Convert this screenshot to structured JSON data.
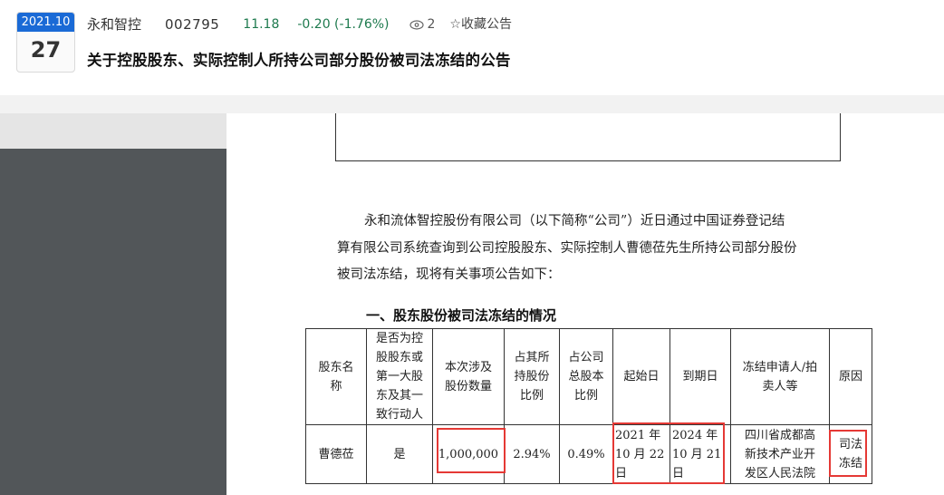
{
  "header": {
    "date_year_month": "2021.10",
    "date_day": "27",
    "company_name": "永和智控",
    "stock_code": "002795",
    "price": "11.18",
    "change": "-0.20 (-1.76%)",
    "view_count": "2",
    "favorite_label": "☆收藏公告",
    "title": "关于控股股东、实际控制人所持公司部分股份被司法冻结的公告"
  },
  "document": {
    "paragraph": [
      "永和流体智控股份有限公司（以下简称“公司”）近日通过中国证券登记结",
      "算有限公司系统查询到公司控股股东、实际控制人曹德莅先生所持公司部分股份",
      "被司法冻结，现将有关事项公告如下："
    ],
    "section_title": "一、股东股份被司法冻结的情况",
    "table": {
      "headers": [
        [
          "股东名",
          "称"
        ],
        [
          "是否为控",
          "股股东或",
          "第一大股",
          "东及其一",
          "致行动人"
        ],
        [
          "本次涉及",
          "股份数量"
        ],
        [
          "占其所",
          "持股份",
          "比例"
        ],
        [
          "占公司",
          "总股本",
          "比例"
        ],
        [
          "起始日"
        ],
        [
          "到期日"
        ],
        [
          "冻结申请人/拍",
          "卖人等"
        ],
        [
          "原因"
        ]
      ],
      "row": {
        "shareholder": "曹德莅",
        "is_controlling": "是",
        "shares": "1,000,000",
        "pct_holdings": "2.94%",
        "pct_total": "0.49%",
        "start_date": [
          "2021 年",
          "10 月 22",
          "日"
        ],
        "end_date": [
          "2024 年",
          "10 月 21",
          "日"
        ],
        "applicant": [
          "四川省成都高",
          "新技术产业开",
          "发区人民法院"
        ],
        "reason": [
          "司法",
          "冻结"
        ]
      }
    }
  },
  "colors": {
    "badge_blue": "#1a6ad6",
    "price_green": "#1e7a4e",
    "highlight_red": "#e53935",
    "viewer_dark": "#525659"
  }
}
